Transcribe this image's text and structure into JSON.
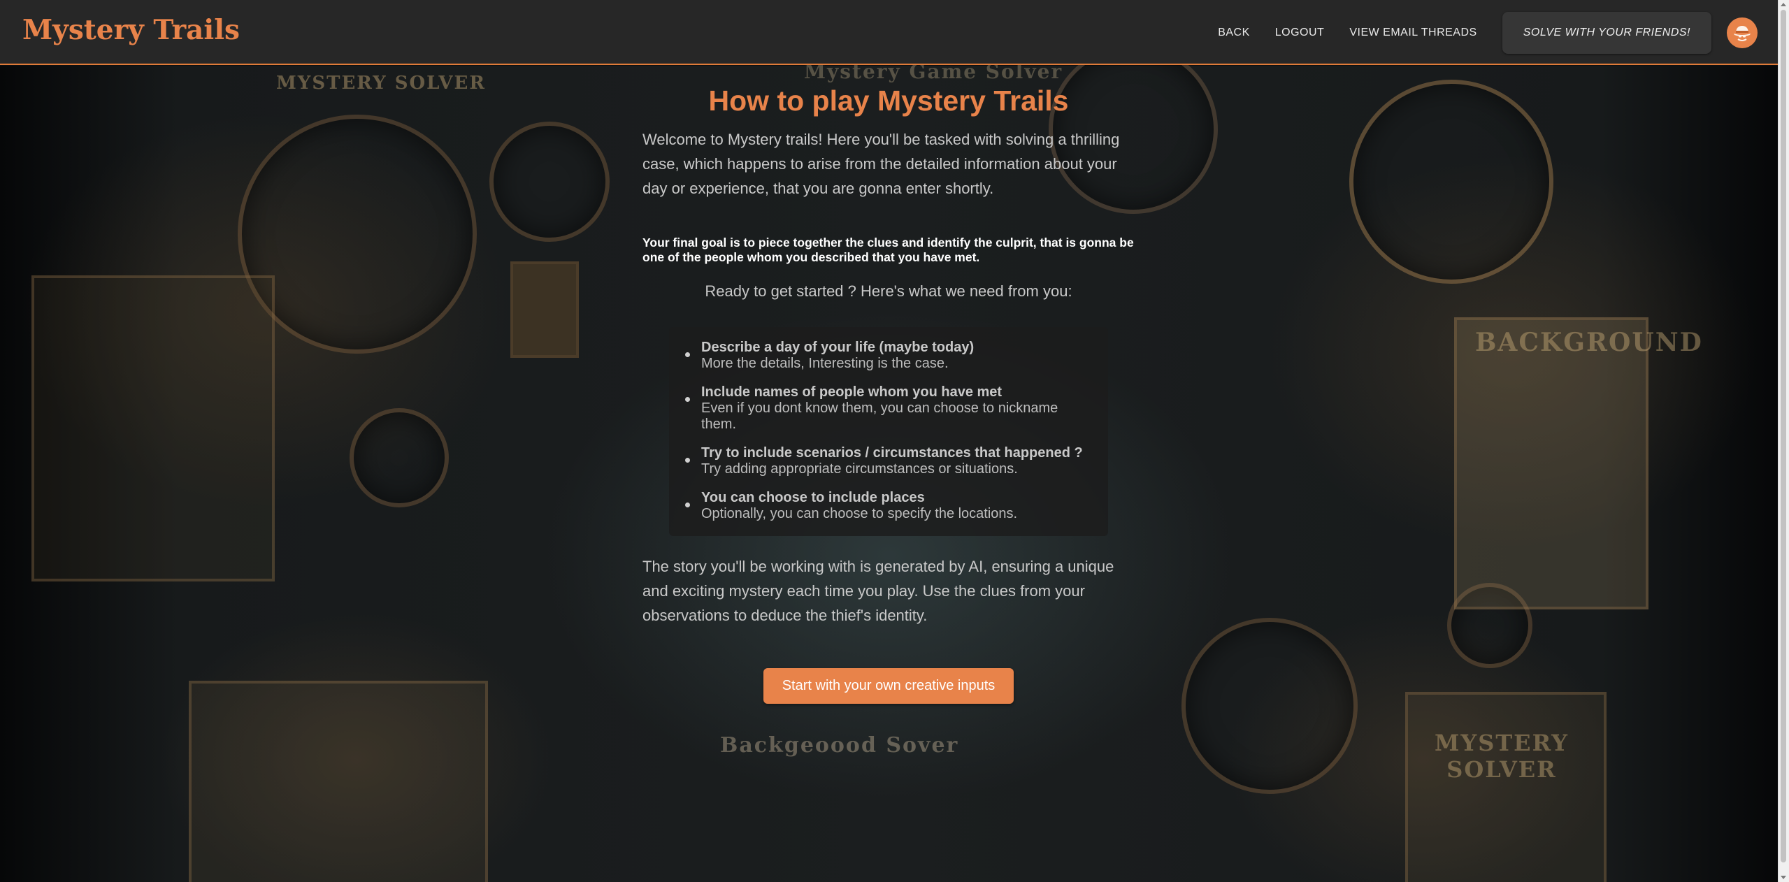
{
  "header": {
    "brand": "Mystery Trails",
    "nav": {
      "back": "BACK",
      "logout": "LOGOUT",
      "email_threads": "VIEW EMAIL THREADS",
      "friends": "SOLVE WITH YOUR FRIENDS!"
    },
    "avatar_icon": "detective-hat-icon"
  },
  "main": {
    "title": "How to play Mystery Trails",
    "intro": "Welcome to Mystery trails! Here you'll be tasked with solving a thrilling case, which happens to arise from the detailed information about your day or experience, that you are gonna enter shortly.",
    "goal": "Your final goal is to piece together the clues and identify the culprit, that is gonna be one of the people whom you described that you have met.",
    "ready": "Ready to get started ? Here's what we need from you:",
    "requirements": [
      {
        "title": "Describe a day of your life (maybe today)",
        "desc": "More the details, Interesting is the case."
      },
      {
        "title": "Include names of people whom you have met",
        "desc": "Even if you dont know them, you can choose to nickname them."
      },
      {
        "title": "Try to include scenarios / circumstances that happened ?",
        "desc": "Try adding appropriate circumstances or situations."
      },
      {
        "title": "You can choose to include places",
        "desc": "Optionally, you can choose to specify the locations."
      }
    ],
    "outro": "The story you'll be working with is generated by AI, ensuring a unique and exciting mystery each time you play. Use the clues from your observations to deduce the thief's identity.",
    "cta": "Start with your own creative inputs"
  },
  "background": {
    "signs": [
      "MYSTERY SOLVER",
      "Mystery Game Solver",
      "BACKGROUND",
      "MYSTERY SOLVER",
      "Backgeoood Sover"
    ]
  },
  "colors": {
    "accent": "#e8834a",
    "header_bg": "#272727",
    "header_border": "#e07b39"
  }
}
